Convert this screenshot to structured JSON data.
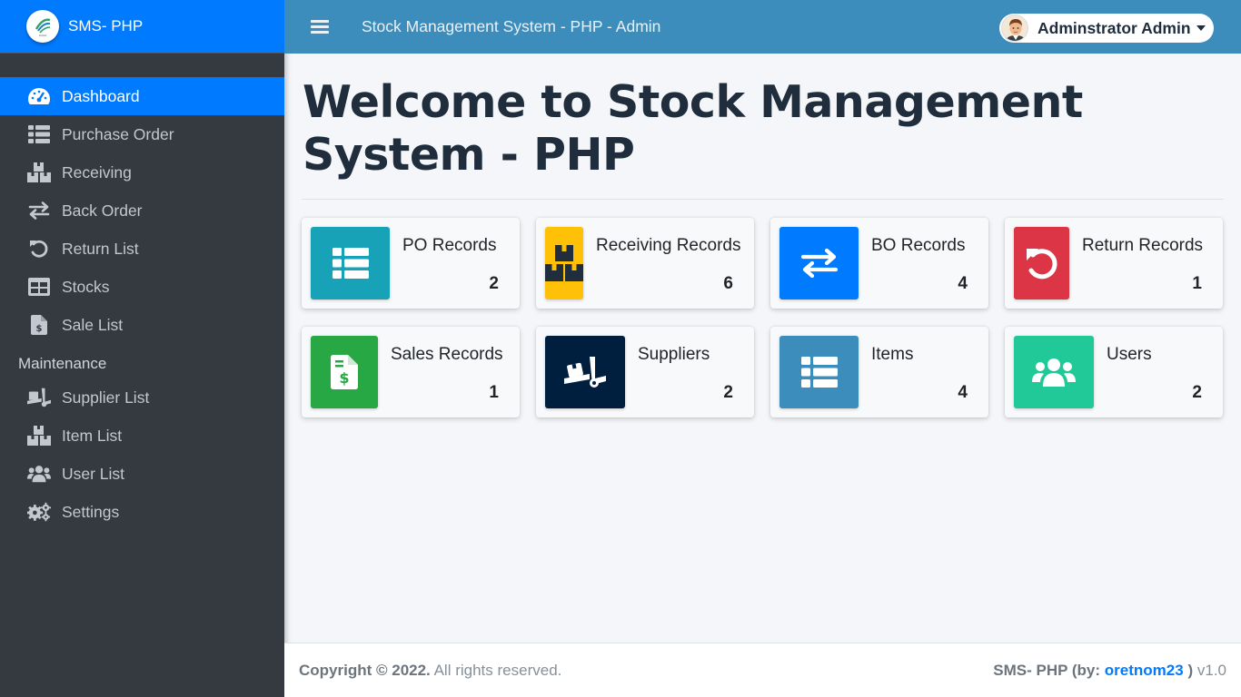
{
  "brand": {
    "name": "SMS- PHP",
    "logo_text": "LOGO"
  },
  "sidebar": {
    "items": [
      {
        "label": "Dashboard",
        "icon": "dashboard-icon",
        "active": true
      },
      {
        "label": "Purchase Order",
        "icon": "table-list-icon"
      },
      {
        "label": "Receiving",
        "icon": "boxes-icon"
      },
      {
        "label": "Back Order",
        "icon": "exchange-icon"
      },
      {
        "label": "Return List",
        "icon": "undo-icon"
      },
      {
        "label": "Stocks",
        "icon": "table-icon"
      },
      {
        "label": "Sale List",
        "icon": "file-invoice-dollar-icon"
      }
    ],
    "maintenance_header": "Maintenance",
    "maintenance_items": [
      {
        "label": "Supplier List",
        "icon": "truck-loading-icon"
      },
      {
        "label": "Item List",
        "icon": "boxes-icon"
      },
      {
        "label": "User List",
        "icon": "users-icon"
      },
      {
        "label": "Settings",
        "icon": "cogs-icon"
      }
    ]
  },
  "topbar": {
    "title": "Stock Management System - PHP - Admin",
    "user_name": "Adminstrator Admin"
  },
  "main": {
    "title": "Welcome to Stock Management System - PHP",
    "cards": [
      {
        "label": "PO Records",
        "value": "2",
        "color": "#17a2b8",
        "icon": "th-list-icon"
      },
      {
        "label": "Receiving Records",
        "value": "6",
        "color": "#ffc107",
        "icon": "boxes-icon"
      },
      {
        "label": "BO Records",
        "value": "4",
        "color": "#007bff",
        "icon": "exchange-icon"
      },
      {
        "label": "Return Records",
        "value": "1",
        "color": "#dc3545",
        "icon": "undo-icon"
      },
      {
        "label": "Sales Records",
        "value": "1",
        "color": "#28a745",
        "icon": "file-invoice-dollar-icon"
      },
      {
        "label": "Suppliers",
        "value": "2",
        "color": "#001f3f",
        "icon": "truck-loading-icon"
      },
      {
        "label": "Items",
        "value": "4",
        "color": "#3c8dbc",
        "icon": "th-list-icon"
      },
      {
        "label": "Users",
        "value": "2",
        "color": "#20c997",
        "icon": "users-icon"
      }
    ]
  },
  "footer": {
    "copyright": "Copyright © 2022.",
    "rights": "All rights reserved.",
    "app": "SMS- PHP (by:",
    "author": "oretnom23",
    "close": ")",
    "version": "v1.0"
  }
}
